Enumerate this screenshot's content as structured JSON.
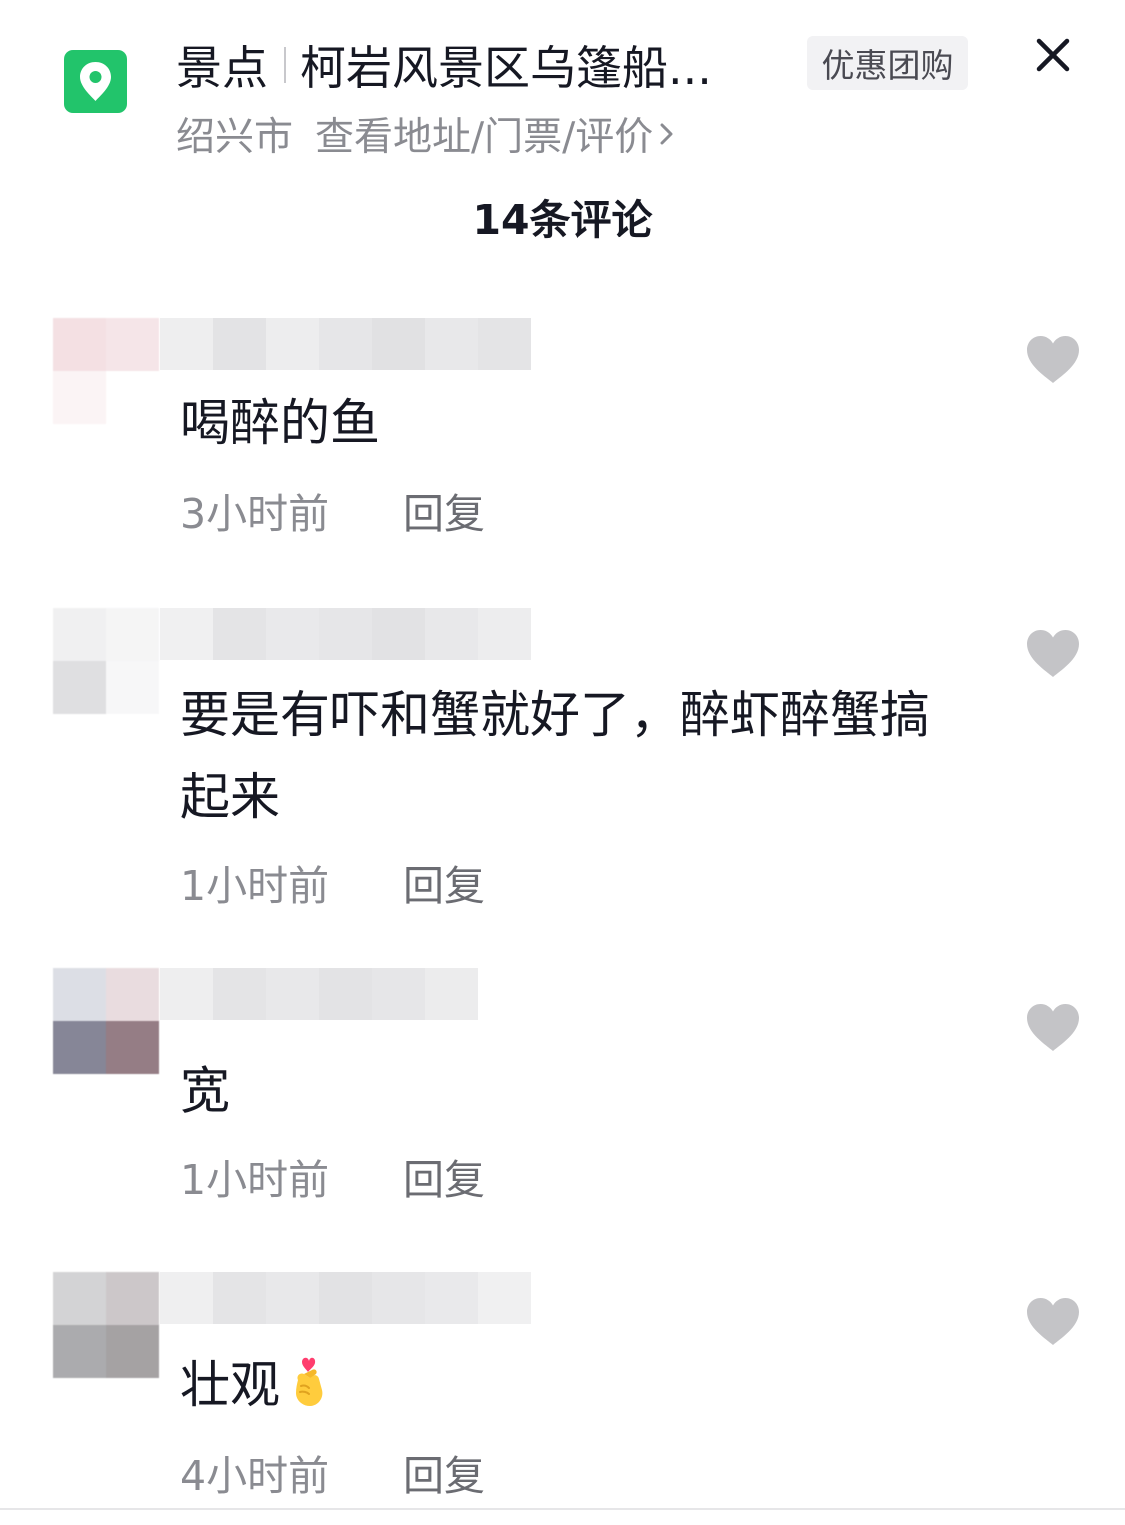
{
  "header": {
    "poi_type": "景点",
    "poi_name": "柯岩风景区乌篷船...",
    "deal_badge": "优惠团购",
    "city": "绍兴市",
    "detail_link": "查看地址/门票/评价",
    "location_icon": "map-pin-icon",
    "close_icon": "close-icon",
    "accent_color": "#22c46b"
  },
  "comment_count_label": "14条评论",
  "comments": [
    {
      "text": "喝醉的鱼",
      "time": "3小时前",
      "reply_label": "回复",
      "emoji": ""
    },
    {
      "text": "要是有吓和蟹就好了，醉虾醉蟹搞起来",
      "time": "1小时前",
      "reply_label": "回复",
      "emoji": ""
    },
    {
      "text": "宽",
      "time": "1小时前",
      "reply_label": "回复",
      "emoji": ""
    },
    {
      "text": "壮观",
      "time": "4小时前",
      "reply_label": "回复",
      "emoji": "finger-heart-emoji"
    }
  ],
  "like_icon": "heart-icon",
  "colors": {
    "text_primary": "#161823",
    "text_secondary": "#8a8b91",
    "heart": "#c4c4c7"
  }
}
